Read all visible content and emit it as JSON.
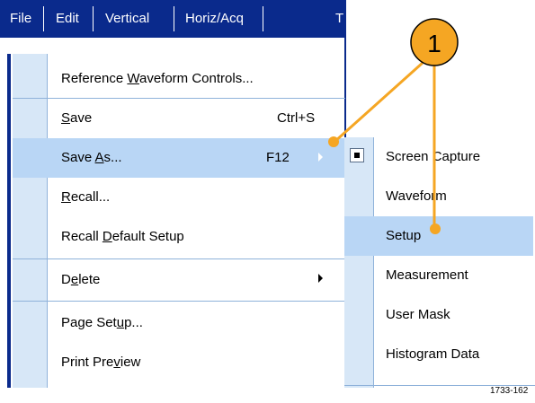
{
  "menubar": {
    "items": [
      "File",
      "Edit",
      "Vertical",
      "Horiz/Acq",
      "T"
    ]
  },
  "file_menu": {
    "items": [
      {
        "pre": "Reference ",
        "u": "W",
        "post": "aveform Controls..."
      },
      {
        "pre": "",
        "u": "S",
        "post": "ave",
        "shortcut": "Ctrl+S"
      },
      {
        "pre": "Save ",
        "u": "A",
        "post": "s...",
        "shortcut": "F12"
      },
      {
        "pre": "",
        "u": "R",
        "post": "ecall..."
      },
      {
        "pre": "Recall ",
        "u": "D",
        "post": "efault Setup"
      },
      {
        "pre": "D",
        "u": "e",
        "post": "lete"
      },
      {
        "pre": "Page Set",
        "u": "u",
        "post": "p..."
      },
      {
        "pre": "Print Pre",
        "u": "v",
        "post": "iew"
      }
    ]
  },
  "save_as_submenu": {
    "items": [
      "Screen Capture",
      "Waveform",
      "Setup",
      "Measurement",
      "User Mask",
      "Histogram Data"
    ],
    "checked": "Screen Capture",
    "highlighted": "Setup"
  },
  "callout": {
    "number": "1",
    "color": "#f5a623"
  },
  "figure_id": "1733-162",
  "colors": {
    "menubar": "#0a2a8c",
    "highlight": "#b9d6f5",
    "gutter": "#d7e7f7",
    "callout": "#f5a623"
  }
}
